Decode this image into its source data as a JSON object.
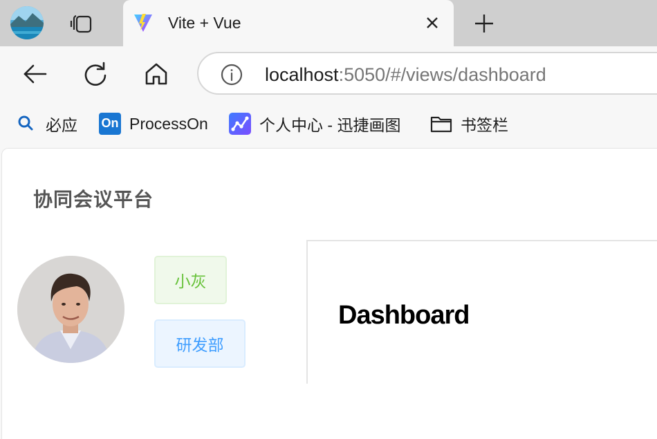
{
  "browser": {
    "tab": {
      "title": "Vite + Vue"
    },
    "address": {
      "host": "localhost",
      "rest": ":5050/#/views/dashboard"
    },
    "favorites": [
      {
        "label": "必应",
        "icon": "search-icon"
      },
      {
        "label": "ProcessOn",
        "icon": "processon-icon",
        "badge": "On"
      },
      {
        "label": "个人中心 - 迅捷画图",
        "icon": "chart-icon"
      },
      {
        "label": "书签栏",
        "icon": "folder-icon"
      }
    ],
    "nav_icons": [
      "back-icon",
      "refresh-icon",
      "home-icon",
      "info-icon"
    ]
  },
  "app": {
    "title": "协同会议平台",
    "user": {
      "name": "小灰",
      "department": "研发部"
    },
    "page_heading": "Dashboard"
  },
  "colors": {
    "tag_green": "#67c23a",
    "tag_blue": "#409eff",
    "tab_strip": "#cfcfcf"
  }
}
